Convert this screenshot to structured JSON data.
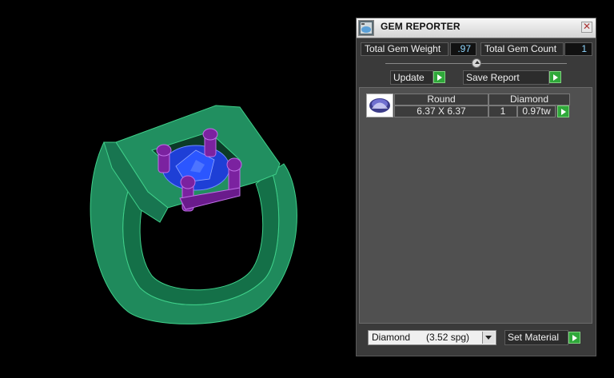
{
  "window": {
    "title": "GEM REPORTER",
    "close_symbol": "✕"
  },
  "stats": {
    "total_gem_weight_label": "Total Gem Weight",
    "total_gem_weight_value": ".97",
    "total_gem_count_label": "Total Gem Count",
    "total_gem_count_value": "1"
  },
  "actions": {
    "update_label": "Update",
    "save_report_label": "Save Report",
    "set_material_label": "Set Material"
  },
  "gem_list": {
    "rows": [
      {
        "shape": "Round",
        "material": "Diamond",
        "size": "6.37 X 6.37",
        "count": "1",
        "weight": "0.97tw"
      }
    ]
  },
  "material_select": {
    "value": "Diamond      (3.52 spg)"
  },
  "colors": {
    "ring_green": "#1f8a5c",
    "gem_blue": "#1e3fd6",
    "prong_purple": "#7b22a0",
    "panel_bg": "#3a3a3a",
    "accent_green": "#2fa83a",
    "value_cyan": "#8fd7ff"
  }
}
